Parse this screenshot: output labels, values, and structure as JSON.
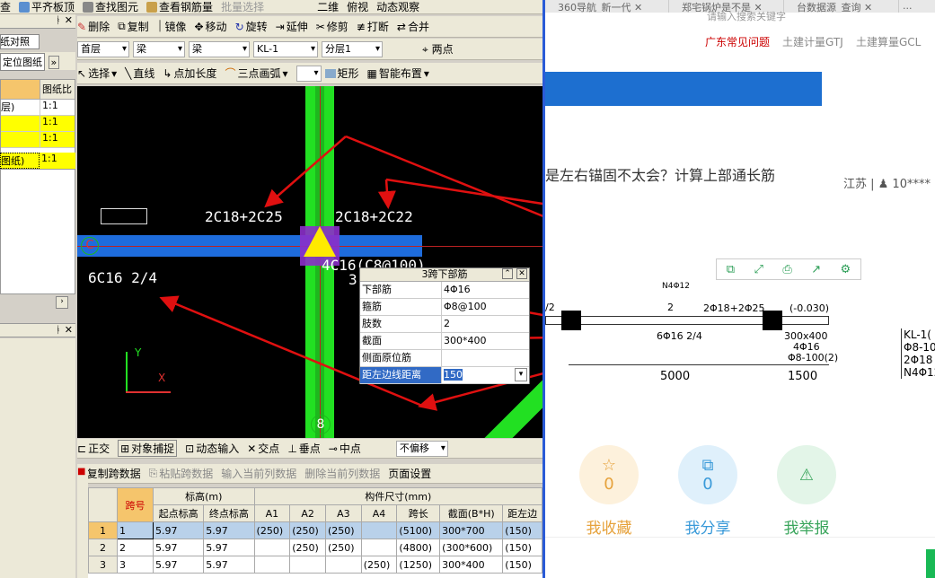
{
  "toolbar1": {
    "items": [
      "查",
      "平齐板顶",
      "查找图元",
      "查看钢筋量",
      "批量选择"
    ],
    "right_items": [
      "二维",
      "俯视",
      "动态观察"
    ]
  },
  "toolbar2": {
    "items": [
      "删除",
      "复制",
      "镜像",
      "移动",
      "旋转",
      "延伸",
      "修剪",
      "打断",
      "合并"
    ]
  },
  "toolbar3": {
    "floor": "首层",
    "type1": "梁",
    "type2": "梁",
    "member": "KL-1",
    "layer": "分层1",
    "two_point": "两点"
  },
  "toolbar4": {
    "items": [
      "选择",
      "直线",
      "点加长度",
      "三点画弧",
      "矩形",
      "智能布置"
    ]
  },
  "leftpanel": {
    "header1": "图纸对照表",
    "header2": "定位图纸",
    "col1": "图纸比",
    "rows": [
      {
        "name": "层)",
        "ratio": "1:1"
      },
      {
        "name": "",
        "ratio": "1:1"
      },
      {
        "name": "",
        "ratio": "1:1"
      },
      {
        "name": "图纸)",
        "ratio": "1:1"
      }
    ]
  },
  "cad": {
    "label_top_left": "2C18+2C25",
    "label_top_right": "2C18+2C22",
    "label_bottom": "4C16(C8@100)",
    "label_left": "6C16 2/4",
    "axis_c": "C",
    "axis_8": "8",
    "num3": "3",
    "axis_y": "Y",
    "axis_x": "X"
  },
  "popup": {
    "title": "3跨下部筋",
    "rows": [
      {
        "k": "下部筋",
        "v": "4Φ16"
      },
      {
        "k": "箍筋",
        "v": "Φ8@100"
      },
      {
        "k": "肢数",
        "v": "2"
      },
      {
        "k": "截面",
        "v": "300*400"
      },
      {
        "k": "侧面原位筋",
        "v": ""
      },
      {
        "k": "距左边线距离",
        "v": "150"
      }
    ]
  },
  "statusbar": {
    "items": [
      "正交",
      "对象捕捉",
      "动态输入",
      "交点",
      "垂点",
      "中点"
    ],
    "offset": "不偏移"
  },
  "gridtoolbar": {
    "items": [
      "复制跨数据",
      "粘贴跨数据",
      "输入当前列数据",
      "删除当前列数据",
      "页面设置"
    ]
  },
  "grid": {
    "h1": [
      "跨号",
      "标高(m)",
      "构件尺寸(mm)"
    ],
    "h2": [
      "起点标高",
      "终点标高",
      "A1",
      "A2",
      "A3",
      "A4",
      "跨长",
      "截面(B*H)",
      "距左边"
    ],
    "rows": [
      [
        "1",
        "1",
        "5.97",
        "5.97",
        "(250)",
        "(250)",
        "(250)",
        "",
        "(5100)",
        "300*700",
        "(150)"
      ],
      [
        "2",
        "2",
        "5.97",
        "5.97",
        "",
        "(250)",
        "(250)",
        "",
        "(4800)",
        "(300*600)",
        "(150)"
      ],
      [
        "3",
        "3",
        "5.97",
        "5.97",
        "",
        "",
        "",
        "(250)",
        "(1250)",
        "300*400",
        "(150)"
      ]
    ]
  },
  "browser": {
    "tabs": [
      "360导航_新一代",
      "郑宅锅炉是不是",
      "台数据源_查询",
      "..."
    ],
    "search_hint": "请输入搜索关键字",
    "links": [
      "广东常见问题",
      "土建计量GTJ",
      "土建算量GCL"
    ],
    "question": "是左右锚固不太会？计算上部通长筋",
    "user": "江苏 | ♟ 10****",
    "drawing": {
      "span1": "5000",
      "span2": "1500",
      "t1": "2Φ18+2Φ25",
      "t2": "2",
      "t3": "(-0.030)",
      "t4": "300x400",
      "t5": "4Φ16",
      "t6": "Φ8-100(2)",
      "t7": "6Φ16 2/4",
      "t8": "/2",
      "t9": "N4Φ12",
      "side": [
        "KL-1(",
        "Φ8-10",
        "2Φ18",
        "N4Φ12"
      ]
    },
    "actions": [
      {
        "label": "我收藏",
        "count": "0"
      },
      {
        "label": "我分享",
        "count": "0"
      },
      {
        "label": "我举报",
        "count": ""
      }
    ]
  }
}
